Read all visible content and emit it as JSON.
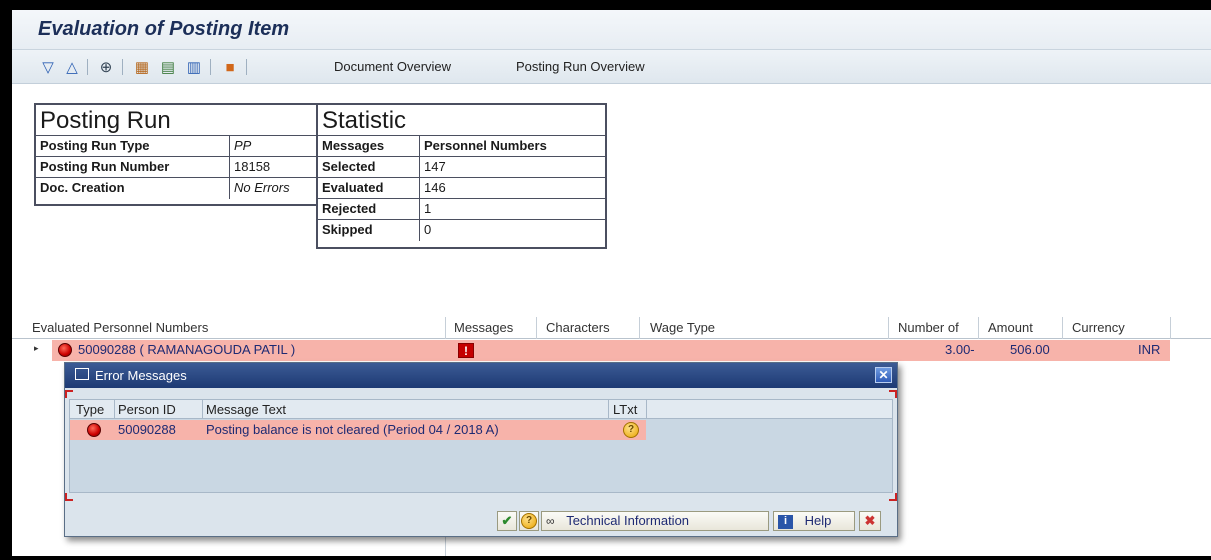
{
  "window": {
    "title": "Evaluation of Posting Item"
  },
  "toolbar": {
    "icons": [
      "expand-all-icon",
      "collapse-all-icon",
      "details-icon",
      "layout-icon",
      "select-layout-icon",
      "save-layout-icon",
      "employee-icon"
    ],
    "document_overview": "Document Overview",
    "posting_run_overview": "Posting Run Overview"
  },
  "posting_run": {
    "header": "Posting Run",
    "rows": [
      {
        "label": "Posting Run Type",
        "value": "PP"
      },
      {
        "label": "Posting Run Number",
        "value": "18158"
      },
      {
        "label": "Doc. Creation",
        "value": "No Errors"
      }
    ]
  },
  "statistic": {
    "header": "Statistic",
    "col_messages": "Messages",
    "col_personnel": "Personnel Numbers",
    "rows": [
      {
        "label": "Selected",
        "value": "147"
      },
      {
        "label": "Evaluated",
        "value": "146"
      },
      {
        "label": "Rejected",
        "value": "1"
      },
      {
        "label": "Skipped",
        "value": "0"
      }
    ]
  },
  "evaluated_list": {
    "columns": {
      "evaluated": "Evaluated Personnel Numbers",
      "messages": "Messages",
      "characters": "Characters",
      "wage_type": "Wage Type",
      "number_of": "Number of",
      "amount": "Amount",
      "currency": "Currency"
    },
    "row": {
      "employee": "50090288 ( RAMANAGOUDA PATIL )",
      "message_flag": "!",
      "number_of": "3.00-",
      "amount": "506.00",
      "currency": "INR"
    }
  },
  "error_dialog": {
    "title": "Error Messages",
    "close": "✕",
    "columns": {
      "type": "Type",
      "person_id": "Person ID",
      "message_text": "Message Text",
      "ltxt": "LTxt"
    },
    "row": {
      "person_id": "50090288",
      "message_text": "Posting balance is not cleared (Period 04 / 2018 A)"
    },
    "buttons": {
      "technical_info": "Technical Information",
      "help": "Help"
    }
  },
  "colors": {
    "error_row": "#f7b3aa",
    "title_text": "#1c2f59",
    "dialog_title": "#1d3a74"
  }
}
